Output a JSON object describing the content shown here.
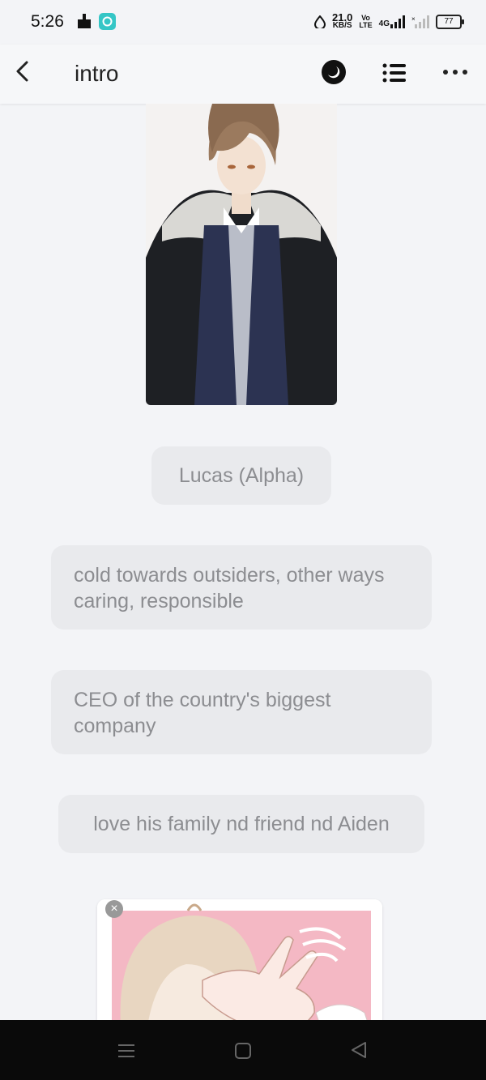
{
  "status_bar": {
    "time": "5:26",
    "net_speed": "21.0",
    "net_speed_unit": "KB/S",
    "volte_top": "Vo",
    "volte_bottom": "LTE",
    "network": "4G",
    "battery": "77"
  },
  "app_bar": {
    "title": "intro",
    "icons": [
      "back-arrow-icon",
      "night-mode-icon",
      "list-icon",
      "more-icon"
    ]
  },
  "bubbles": [
    "Lucas (Alpha)",
    "cold towards outsiders, other ways caring, responsible",
    "CEO of the country's biggest company",
    "love his family nd friend nd Aiden"
  ],
  "colors": {
    "background": "#f3f4f7",
    "bubble": "#e9eaed",
    "bubble_text": "#8c8d91",
    "nav_bar": "#0a0a0a"
  }
}
